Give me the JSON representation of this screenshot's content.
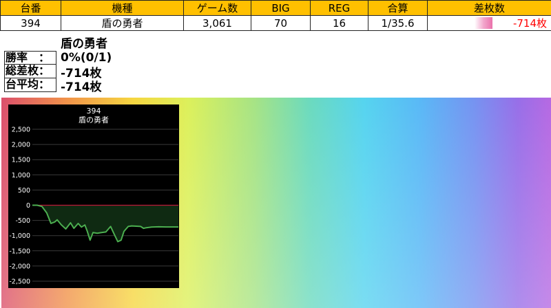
{
  "table": {
    "headers": [
      "台番",
      "機種",
      "ゲーム数",
      "BIG",
      "REG",
      "合算",
      "差枚数"
    ],
    "row": {
      "number": "394",
      "machine": "盾の勇者",
      "games": "3,061",
      "big": "70",
      "reg": "16",
      "combined": "1/35.6",
      "diff": "-714枚",
      "diff_bar_fraction": 0.14
    }
  },
  "info": {
    "title": "盾の勇者",
    "stats": [
      {
        "label": "勝率　：",
        "value": "0%(0/1)"
      },
      {
        "label": "総差枚：",
        "value": "-714枚"
      },
      {
        "label": "台平均：",
        "value": "-714枚"
      }
    ]
  },
  "colors": {
    "header_bg": "#ffc000",
    "diff_text": "#ff0000",
    "line": "#4caf50",
    "zero_line": "#c0183a",
    "fill": "#0f2a12"
  },
  "chart_data": {
    "type": "area",
    "title": "394",
    "subtitle": "盾の勇者",
    "ylim": [
      -2500,
      2500
    ],
    "y_ticks": [
      "2,500",
      "2,000",
      "1,500",
      "1,000",
      "500",
      "0",
      "-500",
      "-1,000",
      "-1,500",
      "-2,000",
      "-2,500"
    ],
    "y_tick_values": [
      2500,
      2000,
      1500,
      1000,
      500,
      0,
      -500,
      -1000,
      -1500,
      -2000,
      -2500
    ],
    "xlim": [
      0,
      3061
    ],
    "grid": true,
    "series": [
      {
        "x": [
          0,
          100,
          200,
          300,
          390,
          470,
          520,
          610,
          700,
          800,
          870,
          960,
          1030,
          1100,
          1150,
          1210,
          1270,
          1360,
          1450,
          1540,
          1640,
          1700,
          1790,
          1860,
          1920,
          2010,
          2080,
          2180,
          2270,
          2330,
          2390,
          2500,
          2650,
          2800,
          2950,
          3061
        ],
        "y": [
          0,
          0,
          -40,
          -250,
          -600,
          -550,
          -480,
          -650,
          -780,
          -580,
          -760,
          -600,
          -720,
          -650,
          -850,
          -1150,
          -900,
          -920,
          -900,
          -880,
          -700,
          -900,
          -1200,
          -1150,
          -860,
          -700,
          -680,
          -690,
          -700,
          -760,
          -740,
          -720,
          -710,
          -714,
          -714,
          -714
        ]
      }
    ]
  }
}
